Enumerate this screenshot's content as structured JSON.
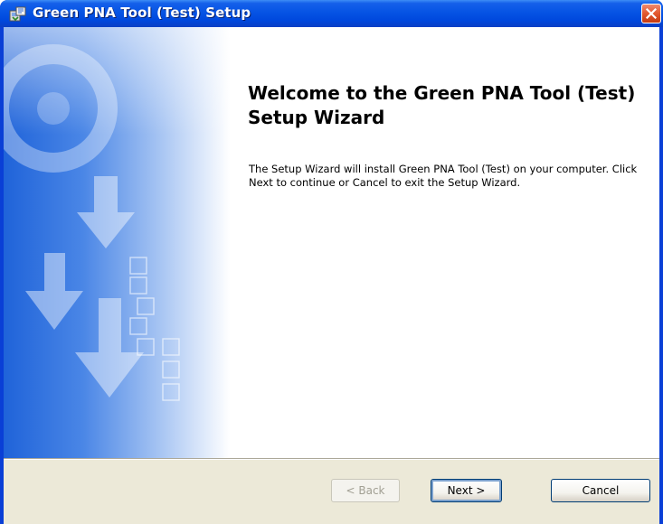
{
  "window": {
    "title": "Green PNA Tool (Test) Setup",
    "icon": "installer-icon",
    "close_icon": "close-icon"
  },
  "welcome": {
    "title": "Welcome to the Green PNA Tool (Test) Setup Wizard",
    "body": "The Setup Wizard will install Green PNA Tool (Test) on your computer.  Click Next to continue or Cancel to exit the Setup Wizard."
  },
  "buttons": {
    "back": "< Back",
    "next": "Next >",
    "cancel": "Cancel"
  },
  "colors": {
    "titlebar": "#0054e3",
    "close_button": "#e2582e",
    "dialog_background": "#ece9d8",
    "banner_accent": "#2f6fd8"
  }
}
